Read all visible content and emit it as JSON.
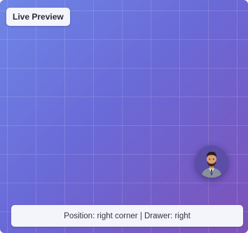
{
  "preview": {
    "badge_label": "Live Preview",
    "status_text": "Position: right corner | Drawer: right"
  },
  "avatar": {
    "icon": "person-avatar-icon"
  },
  "colors": {
    "gradient_start": "#6f86e6",
    "gradient_end": "#7d52b8",
    "panel_bg": "#f4f5fb"
  }
}
